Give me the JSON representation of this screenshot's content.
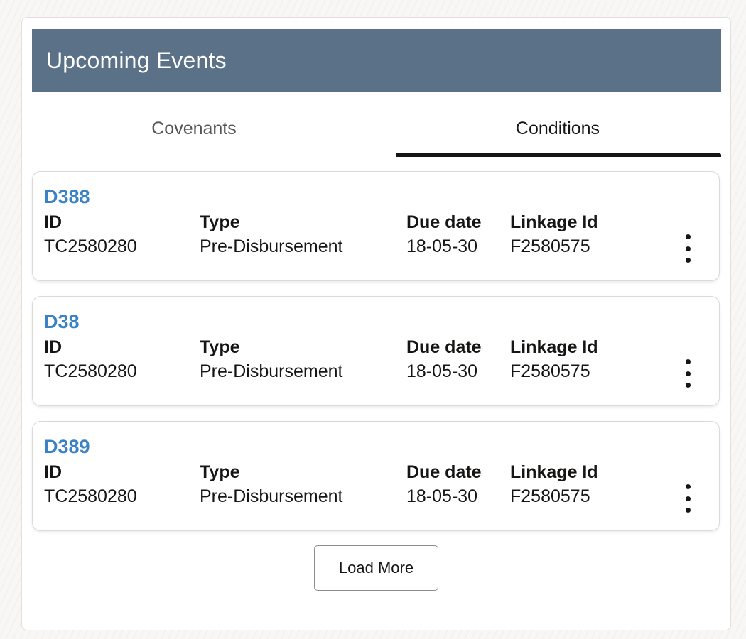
{
  "panel": {
    "title": "Upcoming Events"
  },
  "tabs": [
    {
      "label": "Covenants",
      "selected": false
    },
    {
      "label": "Conditions",
      "selected": true
    }
  ],
  "columns": {
    "id": "ID",
    "type": "Type",
    "due_date": "Due date",
    "linkage_id": "Linkage Id"
  },
  "cards": [
    {
      "name": "D388",
      "id": "TC2580280",
      "type": "Pre-Disbursement",
      "due_date": "18-05-30",
      "linkage_id": "F2580575"
    },
    {
      "name": "D38",
      "id": "TC2580280",
      "type": "Pre-Disbursement",
      "due_date": "18-05-30",
      "linkage_id": "F2580575"
    },
    {
      "name": "D389",
      "id": "TC2580280",
      "type": "Pre-Disbursement",
      "due_date": "18-05-30",
      "linkage_id": "F2580575"
    }
  ],
  "icons": {
    "card_menu": "more-vertical-icon"
  },
  "load_more_label": "Load More",
  "colors": {
    "header_bg": "#5b7188",
    "link": "#3a82c4",
    "text": "#161513"
  }
}
